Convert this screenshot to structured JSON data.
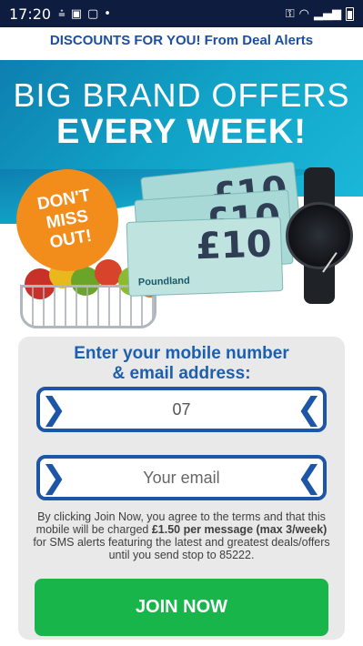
{
  "status_bar": {
    "time": "17:20",
    "left_icons": [
      "cast-icon",
      "image-icon",
      "app-icon",
      "dot-icon"
    ],
    "right_icons": [
      "vpn-key-icon",
      "wifi-icon",
      "signal-icon",
      "battery-icon"
    ]
  },
  "header": {
    "banner_text": "DISCOUNTS FOR YOU! From Deal Alerts"
  },
  "hero": {
    "line1": "BIG BRAND OFFERS",
    "line2": "EVERY WEEK!",
    "badge_lines": [
      "DON'T",
      "MISS",
      "OUT!"
    ],
    "voucher_amount": "£10",
    "voucher_brand": "Poundland"
  },
  "form": {
    "title_line1": "Enter your mobile number",
    "title_line2": "& email address:",
    "mobile_value": "07",
    "email_placeholder": "Your email",
    "terms_before": "By clicking Join Now, you agree to the terms and that this mobile will be charged ",
    "terms_bold": "£1.50 per message (max 3/week)",
    "terms_after": " for SMS alerts featuring the latest and greatest deals/offers until you send stop to 85222.",
    "join_label": "JOIN NOW"
  },
  "colors": {
    "accent_blue": "#1d56a6",
    "button_green": "#18b54b",
    "badge_orange": "#f28c1b",
    "status_bar": "#0d1c3f"
  }
}
